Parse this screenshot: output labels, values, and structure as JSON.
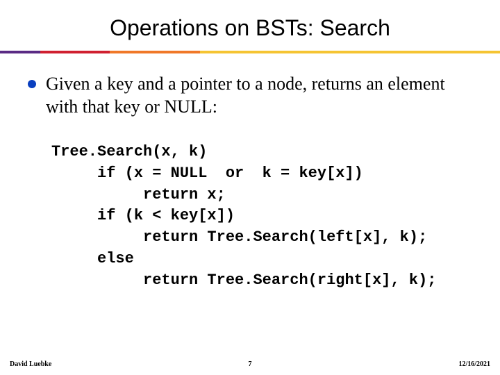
{
  "title": "Operations on BSTs: Search",
  "bullet": "Given a key and a pointer to a node, returns an element with that key or NULL:",
  "code": "Tree.Search(x, k)\n     if (x = NULL  or  k = key[x])\n          return x;\n     if (k < key[x])\n          return Tree.Search(left[x], k);\n     else\n          return Tree.Search(right[x], k);",
  "footer": {
    "author": "David Luebke",
    "page": "7",
    "date": "12/16/2021"
  }
}
